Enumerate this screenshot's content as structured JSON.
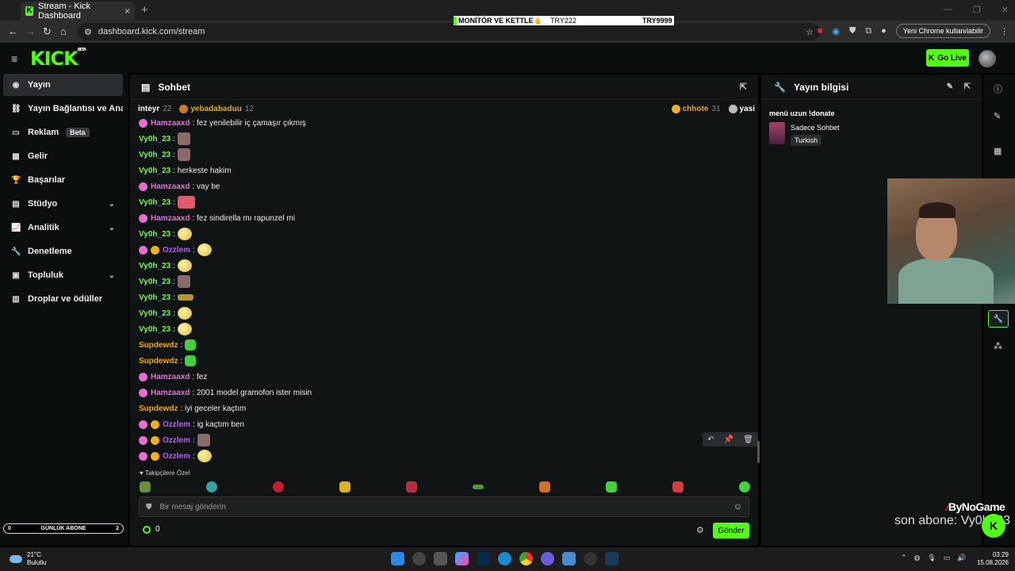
{
  "browser": {
    "tab_title": "Stream - Kick Dashboard",
    "tab_close": "×",
    "new_tab": "+",
    "url": "dashboard.kick.com/stream",
    "update_button": "Yeni Chrome kullanılabilir",
    "window_controls": [
      "—",
      "❐",
      "✕"
    ]
  },
  "ticker": {
    "item1": "MONİTÖR VE KETTLE🖕",
    "item2": "TRY222",
    "item3": "TRY9999"
  },
  "header": {
    "logo": "KICK",
    "logo_sup": "BETA",
    "go_live": "Go Live"
  },
  "sidebar": {
    "items": [
      {
        "label": "Yayın",
        "icon": "stream-icon"
      },
      {
        "label": "Yayın Bağlantısı ve Anahtarı",
        "icon": "link-icon"
      },
      {
        "label": "Reklam",
        "badge": "Beta",
        "icon": "ad-icon"
      },
      {
        "label": "Gelir",
        "icon": "revenue-icon"
      },
      {
        "label": "Başarılar",
        "icon": "trophy-icon"
      },
      {
        "label": "Stüdyo",
        "icon": "studio-icon"
      },
      {
        "label": "Analitik",
        "icon": "analytics-icon"
      },
      {
        "label": "Denetleme",
        "icon": "moderation-icon"
      },
      {
        "label": "Topluluk",
        "icon": "community-icon"
      },
      {
        "label": "Droplar ve ödüller",
        "icon": "drops-icon"
      }
    ]
  },
  "chat": {
    "title": "Sohbet",
    "gifters": [
      {
        "name": "inteyr",
        "count": "22"
      },
      {
        "name": "yebadabaduu",
        "count": "12"
      },
      {
        "name": "chhote",
        "count": "31"
      },
      {
        "name": "yasi",
        "count": ""
      }
    ],
    "messages": [
      {
        "user": "Hamzaaxd",
        "text": "fez yenilebilir iç çamaşır çıkmış"
      },
      {
        "user": "Vy0h_23",
        "text": ""
      },
      {
        "user": "Vy0h_23",
        "text": ""
      },
      {
        "user": "Vy0h_23",
        "text": "herkeste hakim"
      },
      {
        "user": "Hamzaaxd",
        "text": "vay be"
      },
      {
        "user": "Vy0h_23",
        "text": ""
      },
      {
        "user": "Hamzaaxd",
        "text": "fez sindirella mı rapunzel mi"
      },
      {
        "user": "Vy0h_23",
        "text": ""
      },
      {
        "user": "Ozzlem",
        "text": ""
      },
      {
        "user": "Vy0h_23",
        "text": ""
      },
      {
        "user": "Vy0h_23",
        "text": ""
      },
      {
        "user": "Vy0h_23",
        "text": ""
      },
      {
        "user": "Vy0h_23",
        "text": ""
      },
      {
        "user": "Vy0h_23",
        "text": ""
      },
      {
        "user": "Supdewdz",
        "text": ""
      },
      {
        "user": "Supdewdz",
        "text": ""
      },
      {
        "user": "Hamzaaxd",
        "text": "fez"
      },
      {
        "user": "Hamzaaxd",
        "text": "2001 model gramofon ister misin"
      },
      {
        "user": "Supdewdz",
        "text": "iyi geceler kaçtım"
      },
      {
        "user": "Ozzlem",
        "text": "ig kaçtım ben"
      },
      {
        "user": "Ozzlem",
        "text": ""
      },
      {
        "user": "Ozzlem",
        "text": ""
      }
    ],
    "followers_only": "Takipçilere Özel",
    "input_placeholder": "Bir mesaj gönderin",
    "points": "0",
    "send": "Gönder",
    "colors": {
      "accent": "#53fc18"
    }
  },
  "stream_info": {
    "title": "Yayın bilgisi",
    "stream_title": "menü uzun !donate",
    "category": "Sadece Sohbet",
    "language": "Turkish"
  },
  "overlays": {
    "sub_goal_left": "0",
    "sub_goal_label": "GÜNLÜK ABONE",
    "sub_goal_right": "2",
    "brand": "ByNoGame",
    "last_sub_label": "son abone: Vy0h_23"
  },
  "taskbar": {
    "temperature": "21°C",
    "condition": "Bulutlu",
    "time": "03:29",
    "date": "15.08.2026"
  }
}
